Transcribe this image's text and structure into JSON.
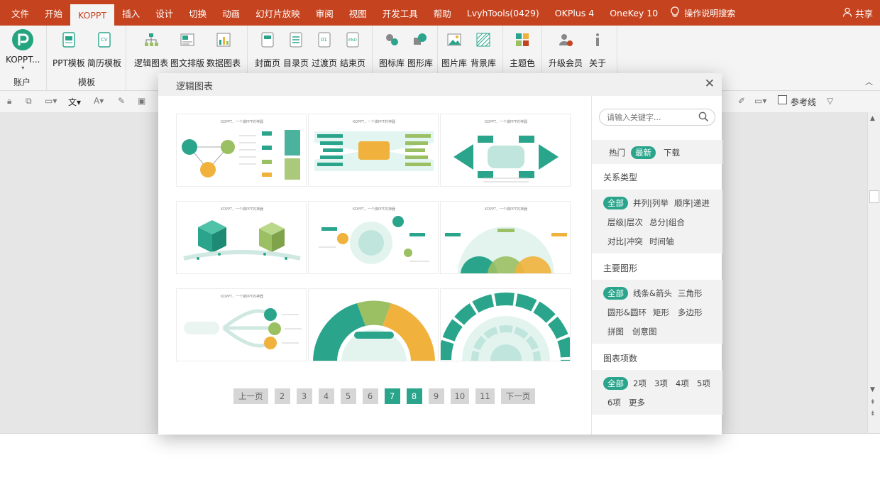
{
  "menubar": {
    "tabs": [
      "文件",
      "开始",
      "KOPPT",
      "插入",
      "设计",
      "切换",
      "动画",
      "幻灯片放映",
      "审阅",
      "视图",
      "开发工具",
      "帮助",
      "LvyhTools(0429)",
      "OKPlus 4",
      "OneKey 10"
    ],
    "active_tab": "KOPPT",
    "search_label": "操作说明搜索",
    "share_label": "共享"
  },
  "ribbon": {
    "account": {
      "button": "KOPPT...",
      "group": "账户"
    },
    "template": {
      "buttons": [
        "PPT模板",
        "简历模板"
      ],
      "group": "模板"
    },
    "buttons": {
      "logic_chart": "逻辑图表",
      "text_layout": "图文排版",
      "data_chart": "数据图表",
      "cover": "封面页",
      "toc": "目录页",
      "transition": "过渡页",
      "ending": "结束页",
      "icon_lib": "图标库",
      "shape_lib": "图形库",
      "image_lib": "图片库",
      "bg_lib": "背景库",
      "theme_color": "主题色",
      "upgrade": "升级会员",
      "about": "关于"
    }
  },
  "toolbar": {
    "guideline_label": "参考线"
  },
  "dialog": {
    "title": "逻辑图表",
    "template_caption": "KOPPT，一个做PPT的神器",
    "pager": {
      "prev": "上一页",
      "pages": [
        "2",
        "3",
        "4",
        "5",
        "6",
        "7",
        "8",
        "9",
        "10",
        "11"
      ],
      "active": [
        "7",
        "8"
      ],
      "next": "下一页"
    },
    "sidebar": {
      "search_placeholder": "请输入关键字...",
      "sort": [
        "热门",
        "最新",
        "下载"
      ],
      "sort_selected": "最新",
      "relation": {
        "title": "关系类型",
        "items": [
          "全部",
          "并列|列举",
          "顺序|递进",
          "层级|层次",
          "总分|组合",
          "对比|冲突",
          "时间轴"
        ]
      },
      "shape": {
        "title": "主要图形",
        "items": [
          "全部",
          "线条&箭头",
          "三角形",
          "圆形&圆环",
          "矩形",
          "多边形",
          "拼图",
          "创意图"
        ]
      },
      "count": {
        "title": "图表项数",
        "items": [
          "全部",
          "2项",
          "3项",
          "4项",
          "5项",
          "6项",
          "更多"
        ]
      }
    }
  },
  "colors": {
    "brand": "#c5431f",
    "accent": "#2aa58c",
    "green_light": "#9bc063",
    "orange": "#f0b23c"
  }
}
